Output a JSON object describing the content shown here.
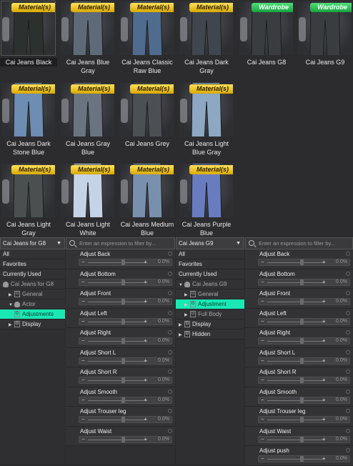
{
  "products": [
    {
      "name": "Cai Jeans Black",
      "badge": "Material(s)",
      "kind": "mat",
      "tone": "#2c302e",
      "selected": true
    },
    {
      "name": "Cai Jeans Blue Gray",
      "badge": "Material(s)",
      "kind": "mat",
      "tone": "#5e6a78"
    },
    {
      "name": "Cai Jeans Classic Raw Blue",
      "badge": "Material(s)",
      "kind": "mat",
      "tone": "#4f6b8e"
    },
    {
      "name": "Cai Jeans Dark Gray",
      "badge": "Material(s)",
      "kind": "mat",
      "tone": "#3f464e"
    },
    {
      "name": "Cai Jeans G8",
      "badge": "Wardrobe",
      "kind": "ward",
      "tone": "#3a3d40"
    },
    {
      "name": "Cai Jeans G9",
      "badge": "Wardrobe",
      "kind": "ward",
      "tone": "#3a3d40"
    },
    {
      "name": "Cai Jeans Dark Stone Blue",
      "badge": "Material(s)",
      "kind": "mat",
      "tone": "#6d8db2"
    },
    {
      "name": "Cai Jeans Gray Blue",
      "badge": "Material(s)",
      "kind": "mat",
      "tone": "#6a7480"
    },
    {
      "name": "Cai Jeans Grey",
      "badge": "Material(s)",
      "kind": "mat",
      "tone": "#4c5055"
    },
    {
      "name": "Cai Jeans Light Blue Gray",
      "badge": "Material(s)",
      "kind": "mat",
      "tone": "#8ea7c2"
    },
    {
      "name": "Cai Jeans Light Gray",
      "badge": "Material(s)",
      "kind": "mat",
      "tone": "#4a5050"
    },
    {
      "name": "Cai Jeans Light White",
      "badge": "Material(s)",
      "kind": "mat",
      "tone": "#c4d3e6"
    },
    {
      "name": "Cai Jeans Medium Blue",
      "badge": "Material(s)",
      "kind": "mat",
      "tone": "#7890ad"
    },
    {
      "name": "Cai Jeans Purple Blue",
      "badge": "Material(s)",
      "kind": "mat",
      "tone": "#6a7cc0"
    }
  ],
  "left_panel": {
    "dropdown": "Cai Jeans for G8",
    "filter_placeholder": "Enter an expression to filter by...",
    "tree": [
      {
        "label": "All",
        "indent": 0,
        "type": "plain"
      },
      {
        "label": "Favorites",
        "indent": 0,
        "type": "plain"
      },
      {
        "label": "Currently Used",
        "indent": 0,
        "type": "plain"
      },
      {
        "label": "Cai Jeans for G8",
        "indent": 0,
        "type": "figure",
        "dim": true
      },
      {
        "label": "General",
        "indent": 1,
        "type": "group",
        "dim": true,
        "arrow": "▶"
      },
      {
        "label": "Actor",
        "indent": 1,
        "type": "figure",
        "dim": true,
        "arrow": "▼"
      },
      {
        "label": "Adjustments",
        "indent": 2,
        "type": "group",
        "highlight": true
      },
      {
        "label": "Display",
        "indent": 1,
        "type": "group",
        "arrow": "▶"
      }
    ],
    "sliders": [
      {
        "label": "Adjust Back",
        "value": "0.0%"
      },
      {
        "label": "Adjust Bottom",
        "value": "0.0%"
      },
      {
        "label": "Adjust Front",
        "value": "0.0%"
      },
      {
        "label": "Adjust Left",
        "value": "0.0%"
      },
      {
        "label": "Adjust Right",
        "value": "0.0%"
      },
      {
        "label": "Adjust Short L",
        "value": "0.0%"
      },
      {
        "label": "Adjust Short R",
        "value": "0.0%"
      },
      {
        "label": "Adjust Smooth",
        "value": "0.0%"
      },
      {
        "label": "Adjust Trouser leg",
        "value": "0.0%"
      },
      {
        "label": "Adjust Waist",
        "value": "0.0%"
      }
    ]
  },
  "right_panel": {
    "dropdown": "Cai Jeans G9",
    "filter_placeholder": "Enter an expression to filter by...",
    "tree": [
      {
        "label": "All",
        "indent": 0,
        "type": "plain"
      },
      {
        "label": "Favorites",
        "indent": 0,
        "type": "plain"
      },
      {
        "label": "Currently Used",
        "indent": 0,
        "type": "plain"
      },
      {
        "label": "Cai Jeans G9",
        "indent": 0,
        "type": "figure",
        "dim": true,
        "arrow": "▼"
      },
      {
        "label": "General",
        "indent": 1,
        "type": "group",
        "dim": true,
        "arrow": "▶"
      },
      {
        "label": "Adjustment",
        "indent": 1,
        "type": "group",
        "highlight": true,
        "arrow": "▶"
      },
      {
        "label": "Full Body",
        "indent": 1,
        "type": "group",
        "dim": true,
        "arrow": "▶"
      },
      {
        "label": "Display",
        "indent": 0,
        "type": "group",
        "arrow": "▶"
      },
      {
        "label": "Hidden",
        "indent": 0,
        "type": "group",
        "arrow": "▶"
      }
    ],
    "sliders": [
      {
        "label": "Adjust Back",
        "value": "0.0%"
      },
      {
        "label": "Adjust Bottom",
        "value": "0.0%"
      },
      {
        "label": "Adjust Front",
        "value": "0.0%"
      },
      {
        "label": "Adjust Left",
        "value": "0.0%"
      },
      {
        "label": "Adjust Right",
        "value": "0.0%"
      },
      {
        "label": "Adjust Short L",
        "value": "0.0%"
      },
      {
        "label": "Adjust Short R",
        "value": "0.0%"
      },
      {
        "label": "Adjust Smooth",
        "value": "0.0%"
      },
      {
        "label": "Adjust Trouser leg",
        "value": "0.0%"
      },
      {
        "label": "Adjust Waist",
        "value": "0.0%"
      },
      {
        "label": "Adjust push",
        "value": "0.0%"
      }
    ]
  },
  "colors": {
    "highlight": "#19e8b4",
    "material_badge": "#f5d21e",
    "wardrobe_badge": "#2ec85a"
  }
}
